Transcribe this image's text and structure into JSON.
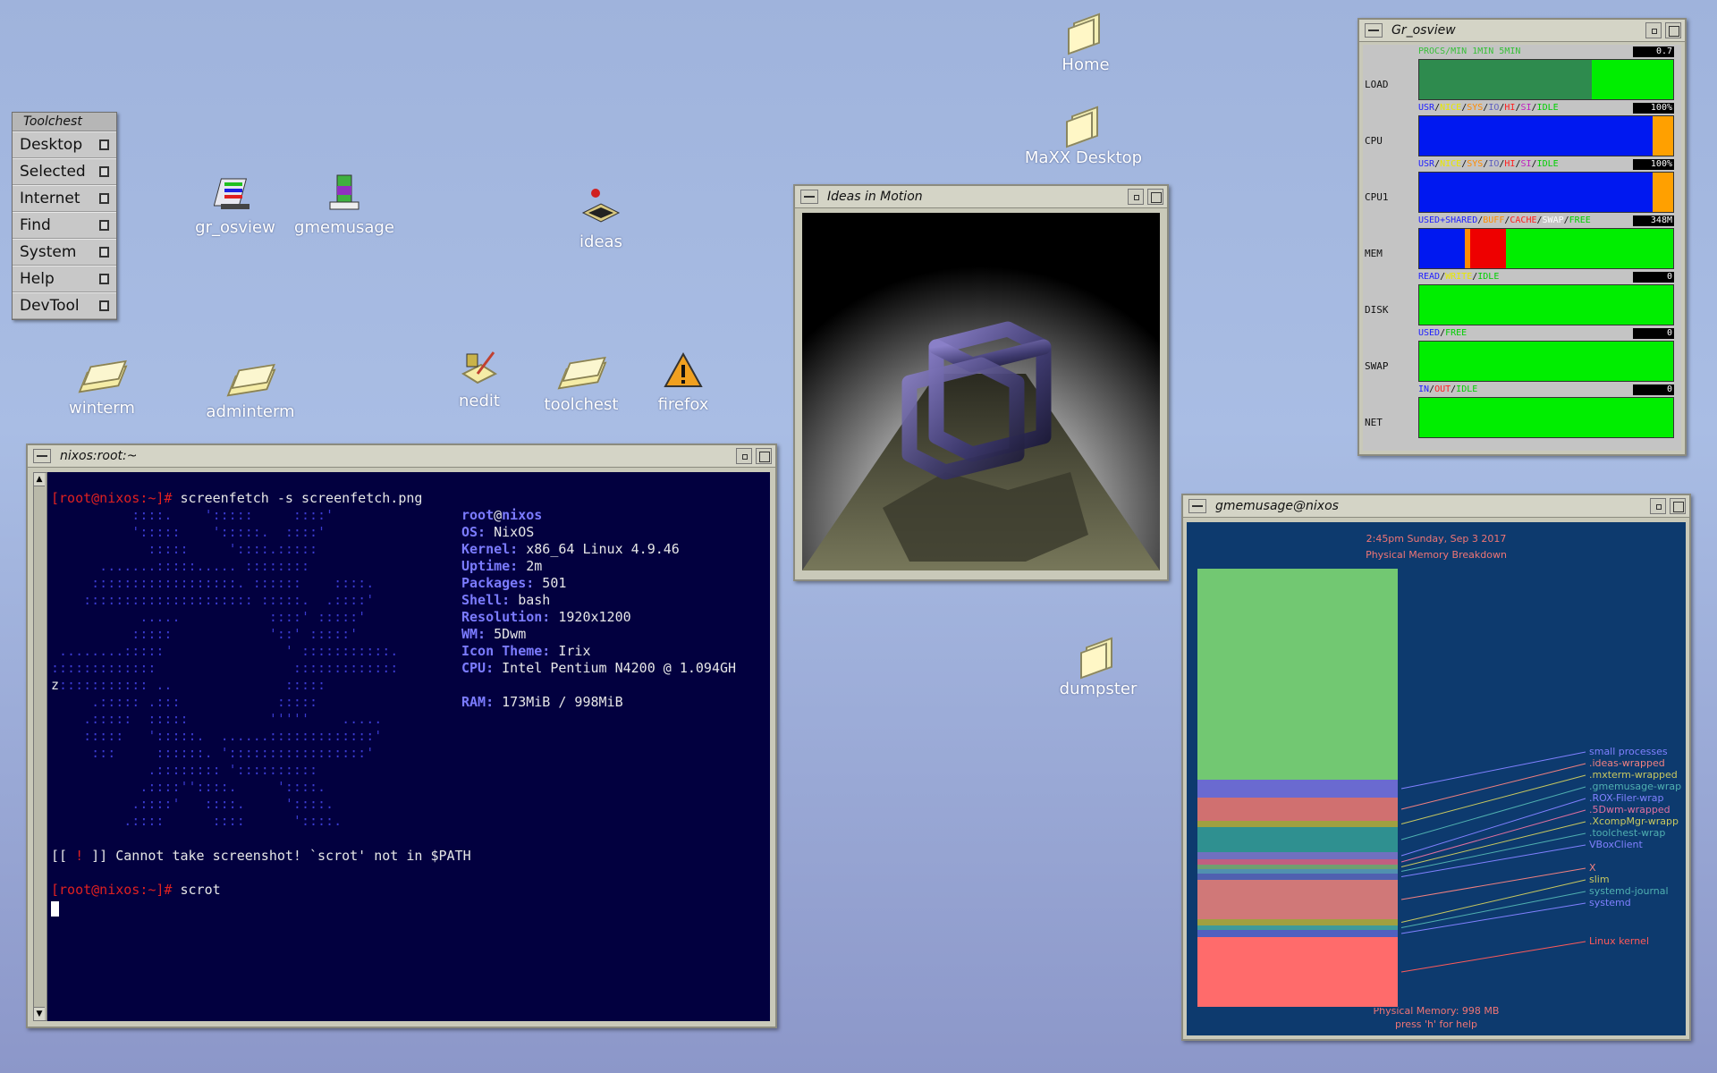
{
  "toolchest": {
    "title": "Toolchest",
    "items": [
      "Desktop",
      "Selected",
      "Internet",
      "Find",
      "System",
      "Help",
      "DevTool"
    ]
  },
  "desktop_icons": {
    "gr_osview": "gr_osview",
    "gmemusage": "gmemusage",
    "ideas": "ideas",
    "winterm": "winterm",
    "adminterm": "adminterm",
    "nedit": "nedit",
    "toolchest": "toolchest",
    "firefox": "firefox",
    "home": "Home",
    "maxx": "MaXX Desktop",
    "dumpster": "dumpster"
  },
  "terminal": {
    "title": "nixos:root:~",
    "prompt1": "[root@nixos:~]#",
    "cmd1": " screenfetch -s screenfetch.png",
    "info": {
      "user": "root",
      "at": "@",
      "host": "nixos",
      "os_label": "OS:",
      "os": " NixOS",
      "kernel_label": "Kernel:",
      "kernel": " x86_64 Linux 4.9.46",
      "uptime_label": "Uptime:",
      "uptime": " 2m",
      "packages_label": "Packages:",
      "packages": " 501",
      "shell_label": "Shell:",
      "shell": " bash",
      "resolution_label": "Resolution:",
      "resolution": " 1920x1200",
      "wm_label": "WM:",
      "wm": " 5Dwm",
      "icon_label": "Icon Theme:",
      "icon": " Irix",
      "cpu_label": "CPU:",
      "cpu": " Intel Pentium N4200 @ 1.094GH",
      "cpu_wrap": "z",
      "ram_label": "RAM:",
      "ram": " 173MiB / 998MiB"
    },
    "ascii": [
      "          ::::.    ':::::     ::::'",
      "          ':::::    ':::::.  ::::'",
      "            :::::     '::::.:::::",
      "      .......:::::..... ::::::::",
      "     ::::::::::::::::::. ::::::    ::::.",
      "    ::::::::::::::::::::: :::::.  .::::'",
      "           .....           ::::' :::::'",
      "          :::::            '::' :::::'",
      " ........:::::               ' :::::::::::.",
      ":::::::::::::                 :::::::::::::",
      " ::::::::::: ..              :::::",
      "     .::::: .:::            :::::",
      "    .:::::  :::::          '''''    .....",
      "    :::::   ':::::.  ......:::::::::::::'",
      "     :::     ::::::. ':::::::::::::::::'",
      "            .:::::::: '::::::::::",
      "           .::::''::::.     '::::.",
      "          .::::'   ::::.     '::::.",
      "         .::::      ::::      '::::."
    ],
    "warn_open": "[[ ",
    "warn_bang": "!",
    "warn_close": " ]]",
    "warn_text": " Cannot take screenshot! `scrot' not in $PATH",
    "prompt2": "[root@nixos:~]#",
    "cmd2": " scrot"
  },
  "ideas_window": {
    "title": "Ideas in Motion"
  },
  "osview": {
    "title": "Gr_osview",
    "rows": [
      {
        "name": "LOAD",
        "legend": [
          {
            "t": "PROCS/",
            "c": "#38c038"
          },
          {
            "t": "MIN 1MIN 5MIN",
            "c": "#38c038"
          }
        ],
        "value": "0.7",
        "segs": [
          {
            "c": "#2e8b4e",
            "w": 0.68
          },
          {
            "c": "#00ee00",
            "w": 0.32
          }
        ]
      },
      {
        "name": "CPU",
        "legend": [
          {
            "t": "USR",
            "c": "#2020ff"
          },
          {
            "t": "/",
            "c": "#111"
          },
          {
            "t": "NICE",
            "c": "#e8e800"
          },
          {
            "t": "/",
            "c": "#111"
          },
          {
            "t": "SYS",
            "c": "#ff8c00"
          },
          {
            "t": "/",
            "c": "#111"
          },
          {
            "t": "IO",
            "c": "#6060c0"
          },
          {
            "t": "/",
            "c": "#111"
          },
          {
            "t": "HI",
            "c": "#ff2020"
          },
          {
            "t": "/",
            "c": "#111"
          },
          {
            "t": "SI",
            "c": "#c020c0"
          },
          {
            "t": "/",
            "c": "#111"
          },
          {
            "t": "IDLE",
            "c": "#00d000"
          }
        ],
        "value": "100%",
        "segs": [
          {
            "c": "#0018f0",
            "w": 0.92
          },
          {
            "c": "#ffa000",
            "w": 0.08
          }
        ]
      },
      {
        "name": "CPU1",
        "legend": [
          {
            "t": "USR",
            "c": "#2020ff"
          },
          {
            "t": "/",
            "c": "#111"
          },
          {
            "t": "NICE",
            "c": "#e8e800"
          },
          {
            "t": "/",
            "c": "#111"
          },
          {
            "t": "SYS",
            "c": "#ff8c00"
          },
          {
            "t": "/",
            "c": "#111"
          },
          {
            "t": "IO",
            "c": "#6060c0"
          },
          {
            "t": "/",
            "c": "#111"
          },
          {
            "t": "HI",
            "c": "#ff2020"
          },
          {
            "t": "/",
            "c": "#111"
          },
          {
            "t": "SI",
            "c": "#c020c0"
          },
          {
            "t": "/",
            "c": "#111"
          },
          {
            "t": "IDLE",
            "c": "#00d000"
          }
        ],
        "value": "100%",
        "segs": [
          {
            "c": "#0018f0",
            "w": 0.92
          },
          {
            "c": "#ffa000",
            "w": 0.08
          }
        ]
      },
      {
        "name": "MEM",
        "legend": [
          {
            "t": "USED+SHARED",
            "c": "#2020ff"
          },
          {
            "t": "/",
            "c": "#111"
          },
          {
            "t": "BUFF",
            "c": "#ff8c00"
          },
          {
            "t": "/",
            "c": "#111"
          },
          {
            "t": "CACHE",
            "c": "#ff2020"
          },
          {
            "t": "/",
            "c": "#111"
          },
          {
            "t": "SWAP",
            "c": "#ffffff"
          },
          {
            "t": "/",
            "c": "#111"
          },
          {
            "t": "FREE",
            "c": "#00d000"
          }
        ],
        "value": "348M",
        "segs": [
          {
            "c": "#0018f0",
            "w": 0.18
          },
          {
            "c": "#ff8c00",
            "w": 0.02
          },
          {
            "c": "#ee0000",
            "w": 0.14
          },
          {
            "c": "#00ee00",
            "w": 0.66
          }
        ]
      },
      {
        "name": "DISK",
        "legend": [
          {
            "t": "READ",
            "c": "#2020ff"
          },
          {
            "t": "/",
            "c": "#111"
          },
          {
            "t": "WRITE",
            "c": "#e8e800"
          },
          {
            "t": "/",
            "c": "#111"
          },
          {
            "t": "IDLE",
            "c": "#00d000"
          }
        ],
        "value": "0",
        "segs": [
          {
            "c": "#00ee00",
            "w": 1
          }
        ]
      },
      {
        "name": "SWAP",
        "legend": [
          {
            "t": "USED",
            "c": "#2020ff"
          },
          {
            "t": "/",
            "c": "#111"
          },
          {
            "t": "FREE",
            "c": "#00d000"
          }
        ],
        "value": "0",
        "segs": [
          {
            "c": "#00ee00",
            "w": 1
          }
        ]
      },
      {
        "name": "NET",
        "legend": [
          {
            "t": "IN",
            "c": "#2020ff"
          },
          {
            "t": "/",
            "c": "#111"
          },
          {
            "t": "OUT",
            "c": "#ff2020"
          },
          {
            "t": "/",
            "c": "#111"
          },
          {
            "t": "IDLE",
            "c": "#00d000"
          }
        ],
        "value": "0",
        "segs": [
          {
            "c": "#00ee00",
            "w": 1
          }
        ]
      }
    ]
  },
  "gmemusage": {
    "title": "gmemusage@nixos",
    "datetime": "2:45pm Sunday, Sep 3 2017",
    "heading": "Physical Memory Breakdown",
    "footer1": "Physical Memory: 998 MB",
    "footer2": "press 'h' for help",
    "segments": [
      {
        "c": "#72c872",
        "h": 236
      },
      {
        "c": "#6a6ad0",
        "h": 20
      },
      {
        "c": "#d07070",
        "h": 26
      },
      {
        "c": "#a0a040",
        "h": 7
      },
      {
        "c": "#2f9090",
        "h": 28
      },
      {
        "c": "#7070c0",
        "h": 8
      },
      {
        "c": "#c06080",
        "h": 6
      },
      {
        "c": "#70a070",
        "h": 5
      },
      {
        "c": "#5090b0",
        "h": 5
      },
      {
        "c": "#5060b0",
        "h": 7
      },
      {
        "c": "#d07878",
        "h": 44
      },
      {
        "c": "#a0a040",
        "h": 7
      },
      {
        "c": "#3f9a9a",
        "h": 5
      },
      {
        "c": "#5060c0",
        "h": 8
      },
      {
        "c": "#ff6b6b",
        "h": 78
      }
    ],
    "labels": [
      {
        "t": "small processes",
        "c": "#8080ff"
      },
      {
        "t": ".ideas-wrapped",
        "c": "#f08080"
      },
      {
        "t": ".mxterm-wrapped",
        "c": "#c8c860"
      },
      {
        "t": ".gmemusage-wrap",
        "c": "#50b0b0"
      },
      {
        "t": ".ROX-Filer-wrap",
        "c": "#8080ff"
      },
      {
        "t": ".5Dwm-wrapped",
        "c": "#e070a0"
      },
      {
        "t": ".XcompMgr-wrapp",
        "c": "#c8c860"
      },
      {
        "t": ".toolchest-wrap",
        "c": "#50b0b0"
      },
      {
        "t": "VBoxClient",
        "c": "#8080ff"
      },
      {
        "t": "X",
        "c": "#f08080"
      },
      {
        "t": "slim",
        "c": "#c8c860"
      },
      {
        "t": "systemd-journal",
        "c": "#50b0b0"
      },
      {
        "t": "systemd",
        "c": "#8080ff"
      },
      {
        "t": "Linux kernel",
        "c": "#ff5a5a"
      }
    ]
  }
}
